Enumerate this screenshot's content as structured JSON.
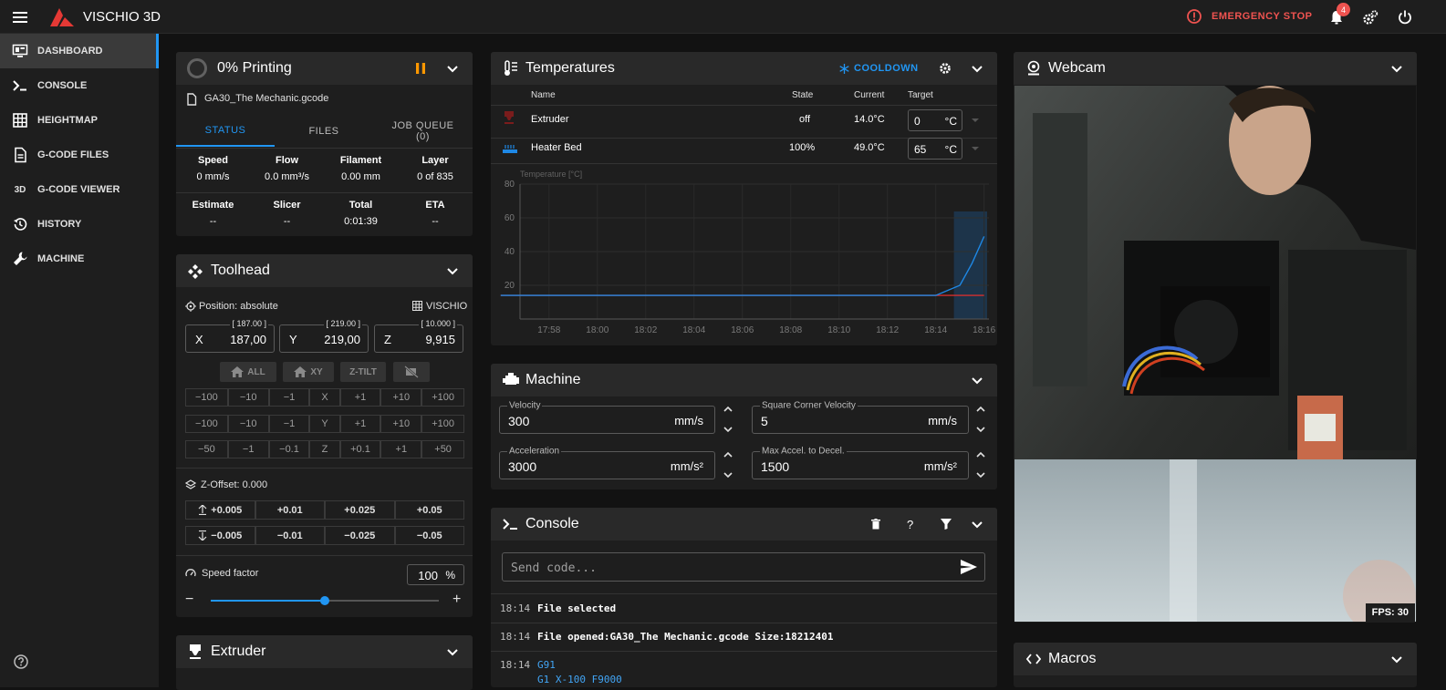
{
  "app": {
    "title": "VISCHIO 3D",
    "emergency": "EMERGENCY STOP",
    "notif_count": "4"
  },
  "nav": [
    {
      "label": "DASHBOARD",
      "icon": "monitor-dashboard-icon"
    },
    {
      "label": "CONSOLE",
      "icon": "console-icon"
    },
    {
      "label": "HEIGHTMAP",
      "icon": "grid-icon"
    },
    {
      "label": "G-CODE FILES",
      "icon": "file-document-icon"
    },
    {
      "label": "G-CODE VIEWER",
      "icon": "3d-icon"
    },
    {
      "label": "HISTORY",
      "icon": "history-icon"
    },
    {
      "label": "MACHINE",
      "icon": "wrench-icon"
    }
  ],
  "nav_3d_text": "3D",
  "status": {
    "title": "0% Printing",
    "progress": 0,
    "file": "GA30_The Mechanic.gcode",
    "tabs": [
      "STATUS",
      "FILES",
      "JOB QUEUE (0)"
    ],
    "stats1": [
      {
        "label": "Speed",
        "value": "0 mm/s"
      },
      {
        "label": "Flow",
        "value": "0.0 mm³/s"
      },
      {
        "label": "Filament",
        "value": "0.00 mm"
      },
      {
        "label": "Layer",
        "value": "0 of 835"
      }
    ],
    "stats2": [
      {
        "label": "Estimate",
        "value": "--"
      },
      {
        "label": "Slicer",
        "value": "--"
      },
      {
        "label": "Total",
        "value": "0:01:39"
      },
      {
        "label": "ETA",
        "value": "--"
      }
    ]
  },
  "toolhead": {
    "title": "Toolhead",
    "position_label": "Position: absolute",
    "profile": "VISCHIO",
    "axes": [
      {
        "name": "X",
        "value": "187,00",
        "target": "[ 187.00 ]"
      },
      {
        "name": "Y",
        "value": "219,00",
        "target": "[ 219.00 ]"
      },
      {
        "name": "Z",
        "value": "9,915",
        "target": "[ 10.000 ]"
      }
    ],
    "home_buttons": [
      "ALL",
      "XY",
      "Z-TILT"
    ],
    "jog_x": [
      "−100",
      "−10",
      "−1",
      "X",
      "+1",
      "+10",
      "+100"
    ],
    "jog_y": [
      "−100",
      "−10",
      "−1",
      "Y",
      "+1",
      "+10",
      "+100"
    ],
    "jog_z": [
      "−50",
      "−1",
      "−0.1",
      "Z",
      "+0.1",
      "+1",
      "+50"
    ],
    "zoffset_label": "Z-Offset: 0.000",
    "zoff_up": [
      "+0.005",
      "+0.01",
      "+0.025",
      "+0.05"
    ],
    "zoff_down": [
      "−0.005",
      "−0.01",
      "−0.025",
      "−0.05"
    ],
    "speed_label": "Speed factor",
    "speed_value": "100",
    "speed_unit": "%",
    "speed_fraction": 0.5,
    "minus": "−",
    "plus": "+"
  },
  "extruder": {
    "title": "Extruder"
  },
  "temps": {
    "title": "Temperatures",
    "cooldown": "COOLDOWN",
    "headers": [
      "Name",
      "State",
      "Current",
      "Target"
    ],
    "rows": [
      {
        "name": "Extruder",
        "state": "off",
        "current": "14.0°C",
        "target": "0",
        "unit": "°C",
        "color": "#d32f2f"
      },
      {
        "name": "Heater Bed",
        "state": "100%",
        "current": "49.0°C",
        "target": "65",
        "unit": "°C",
        "color": "#1e88e5"
      }
    ]
  },
  "chart_data": {
    "type": "line",
    "ylabel": "Temperature [°C]",
    "ylim": [
      0,
      80
    ],
    "yticks": [
      "80",
      "60",
      "40",
      "20"
    ],
    "xticks": [
      "17:58",
      "18:00",
      "18:02",
      "18:04",
      "18:06",
      "18:08",
      "18:10",
      "18:12",
      "18:14",
      "18:16"
    ],
    "grid": true,
    "series": [
      {
        "color": "#d32f2f",
        "points": [
          [
            "17:56",
            14
          ],
          [
            "18:14",
            14
          ],
          [
            "18:15",
            14
          ],
          [
            "18:16",
            14
          ]
        ]
      },
      {
        "color": "#1e88e5",
        "points": [
          [
            "17:56",
            14
          ],
          [
            "18:14",
            14
          ],
          [
            "18:15",
            20
          ],
          [
            "18:15:30",
            33
          ],
          [
            "18:16",
            49
          ]
        ]
      }
    ],
    "highlight_from": "18:14:45"
  },
  "machine": {
    "title": "Machine",
    "fields": [
      {
        "label": "Velocity",
        "value": "300",
        "unit": "mm/s"
      },
      {
        "label": "Square Corner Velocity",
        "value": "5",
        "unit": "mm/s"
      },
      {
        "label": "Acceleration",
        "value": "3000",
        "unit": "mm/s²"
      },
      {
        "label": "Max Accel. to Decel.",
        "value": "1500",
        "unit": "mm/s²"
      }
    ]
  },
  "console": {
    "title": "Console",
    "help": "?",
    "placeholder": "Send code...",
    "entries": [
      {
        "time": "18:14",
        "text": "File selected"
      },
      {
        "time": "18:14",
        "text": "File opened:GA30_The Mechanic.gcode Size:18212401"
      },
      {
        "time": "18:14",
        "text": "G91"
      }
    ],
    "extra": "G1 X-100 F9000"
  },
  "webcam": {
    "title": "Webcam",
    "fps": "FPS: 30"
  },
  "macros": {
    "title": "Macros"
  }
}
